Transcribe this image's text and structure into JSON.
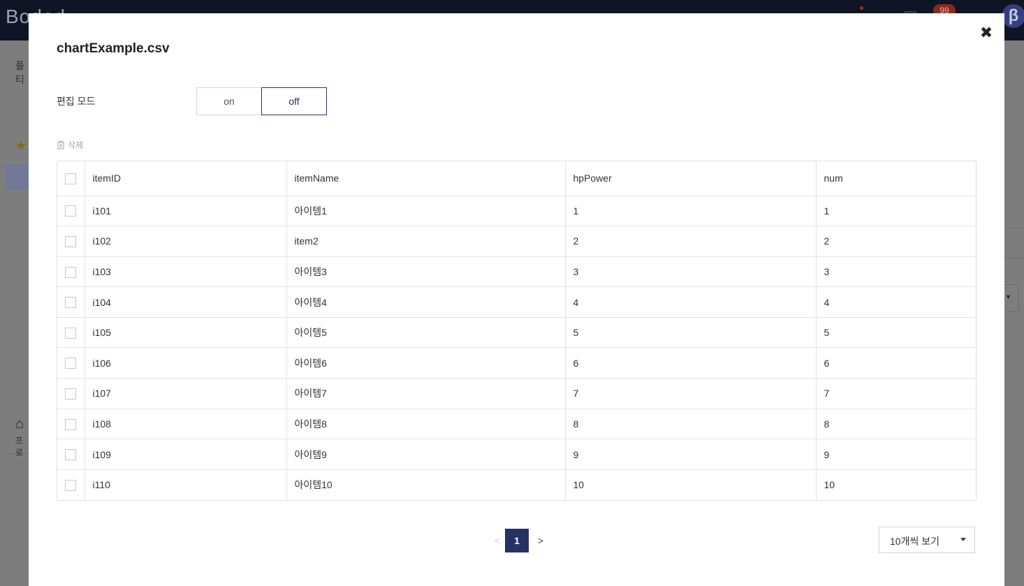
{
  "background": {
    "logo": "Bodod",
    "notification_count": "99",
    "avatar_letter": "β",
    "left_label_1": "플티",
    "left_label_2": "프로"
  },
  "modal": {
    "title": "chartExample.csv",
    "edit_mode_label": "편집 모드",
    "toggle": {
      "on_label": "on",
      "off_label": "off",
      "selected": "off"
    },
    "delete_label": "삭제",
    "close_icon": "close-icon",
    "table": {
      "columns": [
        "itemID",
        "itemName",
        "hpPower",
        "num"
      ],
      "rows": [
        [
          "i101",
          "아이템1",
          "1",
          "1"
        ],
        [
          "i102",
          "item2",
          "2",
          "2"
        ],
        [
          "i103",
          "아이템3",
          "3",
          "3"
        ],
        [
          "i104",
          "아이템4",
          "4",
          "4"
        ],
        [
          "i105",
          "아이템5",
          "5",
          "5"
        ],
        [
          "i106",
          "아이템6",
          "6",
          "6"
        ],
        [
          "i107",
          "아이템7",
          "7",
          "7"
        ],
        [
          "i108",
          "아이템8",
          "8",
          "8"
        ],
        [
          "i109",
          "아이템9",
          "9",
          "9"
        ],
        [
          "i110",
          "아이템10",
          "10",
          "10"
        ]
      ]
    },
    "pagination": {
      "prev": "<",
      "current": "1",
      "next": ">"
    },
    "page_size": {
      "selected": "10개씩 보기"
    }
  },
  "colors": {
    "accent": "#283164",
    "overlay": "#7d7d7d",
    "topbar": "#0f1524"
  }
}
